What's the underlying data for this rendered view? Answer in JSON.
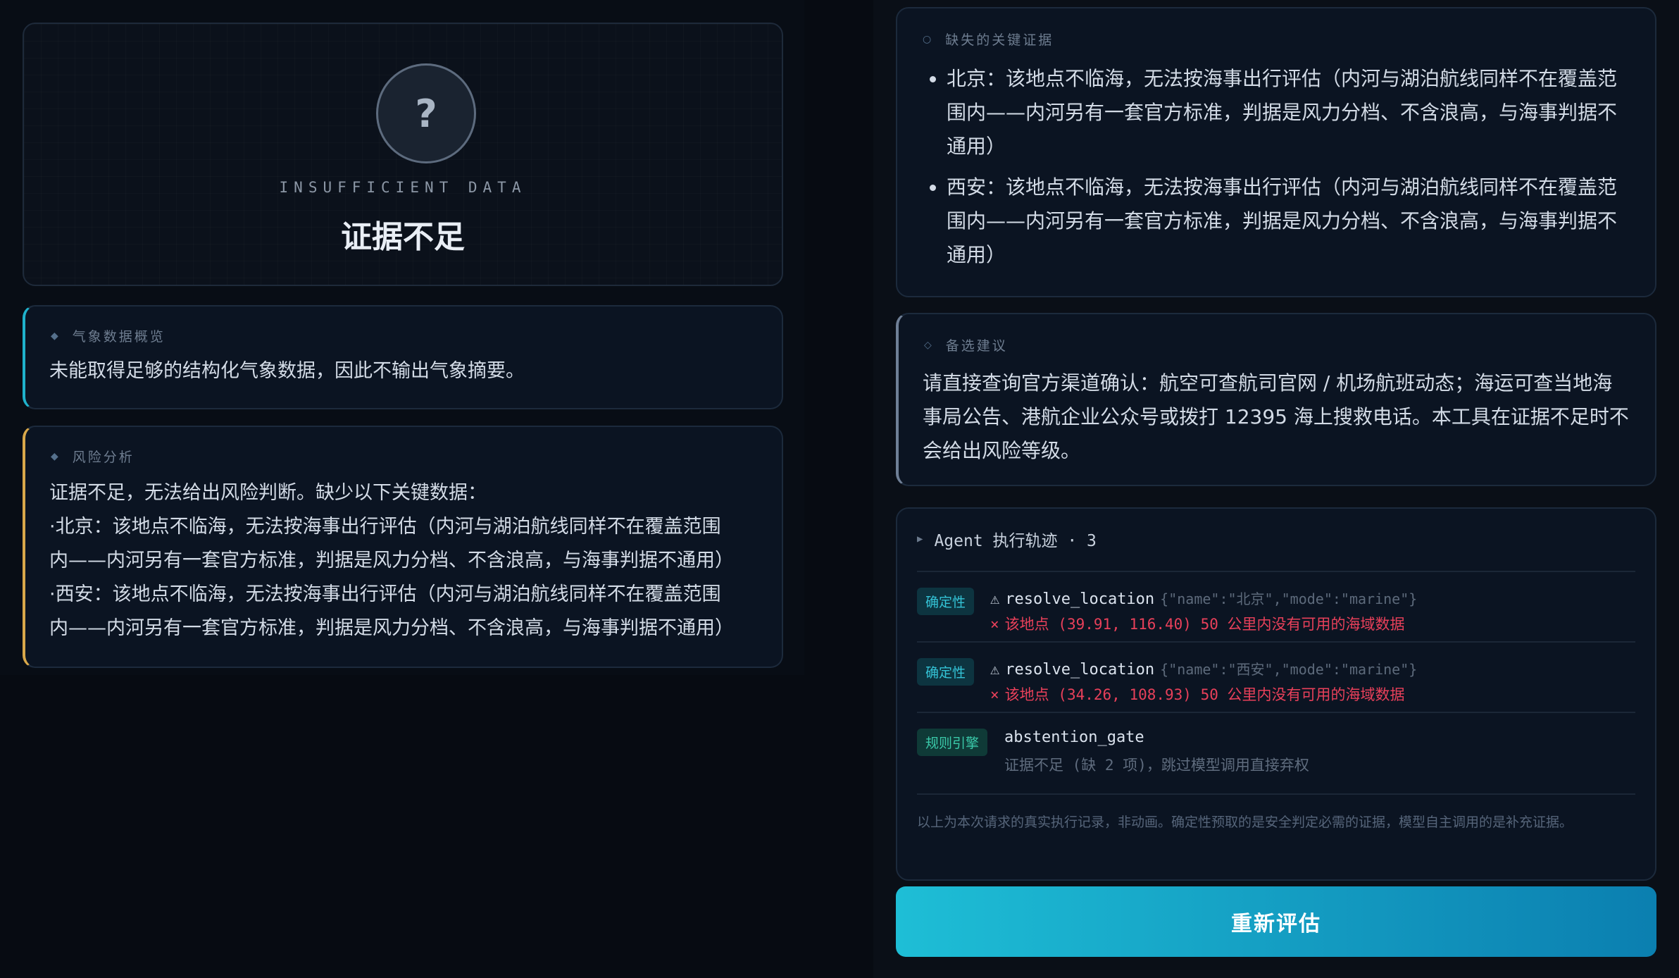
{
  "verdict": {
    "icon": "?",
    "code": "INSUFFICIENT DATA",
    "title": "证据不足"
  },
  "weather_overview": {
    "title": "气象数据概览",
    "text": "未能取得足够的结构化气象数据，因此不输出气象摘要。"
  },
  "risk_analysis": {
    "title": "风险分析",
    "lines": [
      "证据不足，无法给出风险判断。缺少以下关键数据：",
      "·北京：该地点不临海，无法按海事出行评估（内河与湖泊航线同样不在覆盖范围",
      "内——内河另有一套官方标准，判据是风力分档、不含浪高，与海事判据不通用）",
      "·西安：该地点不临海，无法按海事出行评估（内河与湖泊航线同样不在覆盖范围",
      "内——内河另有一套官方标准，判据是风力分档、不含浪高，与海事判据不通用）"
    ]
  },
  "missing_evidence": {
    "title": "缺失的关键证据",
    "items": [
      "北京：该地点不临海，无法按海事出行评估（内河与湖泊航线同样不在覆盖范围内——内河另有一套官方标准，判据是风力分档、不含浪高，与海事判据不通用）",
      "西安：该地点不临海，无法按海事出行评估（内河与湖泊航线同样不在覆盖范围内——内河另有一套官方标准，判据是风力分档、不含浪高，与海事判据不通用）"
    ]
  },
  "alternatives": {
    "title": "备选建议",
    "text": "请直接查询官方渠道确认：航空可查航司官网 / 机场航班动态；海运可查当地海事局公告、港航企业公众号或拨打 12395 海上搜救电话。本工具在证据不足时不会给出风险等级。"
  },
  "trace": {
    "title": "Agent 执行轨迹 · 3",
    "rows": [
      {
        "tag": "确定性",
        "warn": "⚠",
        "tool": "resolve_location",
        "args": "{\"name\":\"北京\",\"mode\":\"marine\"}",
        "result_mark": "×",
        "result": "该地点 (39.91, 116.40) 50 公里内没有可用的海域数据"
      },
      {
        "tag": "确定性",
        "warn": "⚠",
        "tool": "resolve_location",
        "args": "{\"name\":\"西安\",\"mode\":\"marine\"}",
        "result_mark": "×",
        "result": "该地点 (34.26, 108.93) 50 公里内没有可用的海域数据"
      },
      {
        "tag": "规则引擎",
        "tool": "abstention_gate",
        "result": "证据不足 (缺 2 项)，跳过模型调用直接弃权"
      }
    ],
    "footnote": "以上为本次请求的真实执行记录，非动画。确定性预取的是安全判定必需的证据，模型自主调用的是补充证据。"
  },
  "actions": {
    "reevaluate": "重新评估"
  },
  "colors": {
    "accent_cyan": "#1ebed6",
    "accent_amber": "#d9a84a",
    "error_red": "#e8405a",
    "rule_green": "#3ac9a9"
  }
}
